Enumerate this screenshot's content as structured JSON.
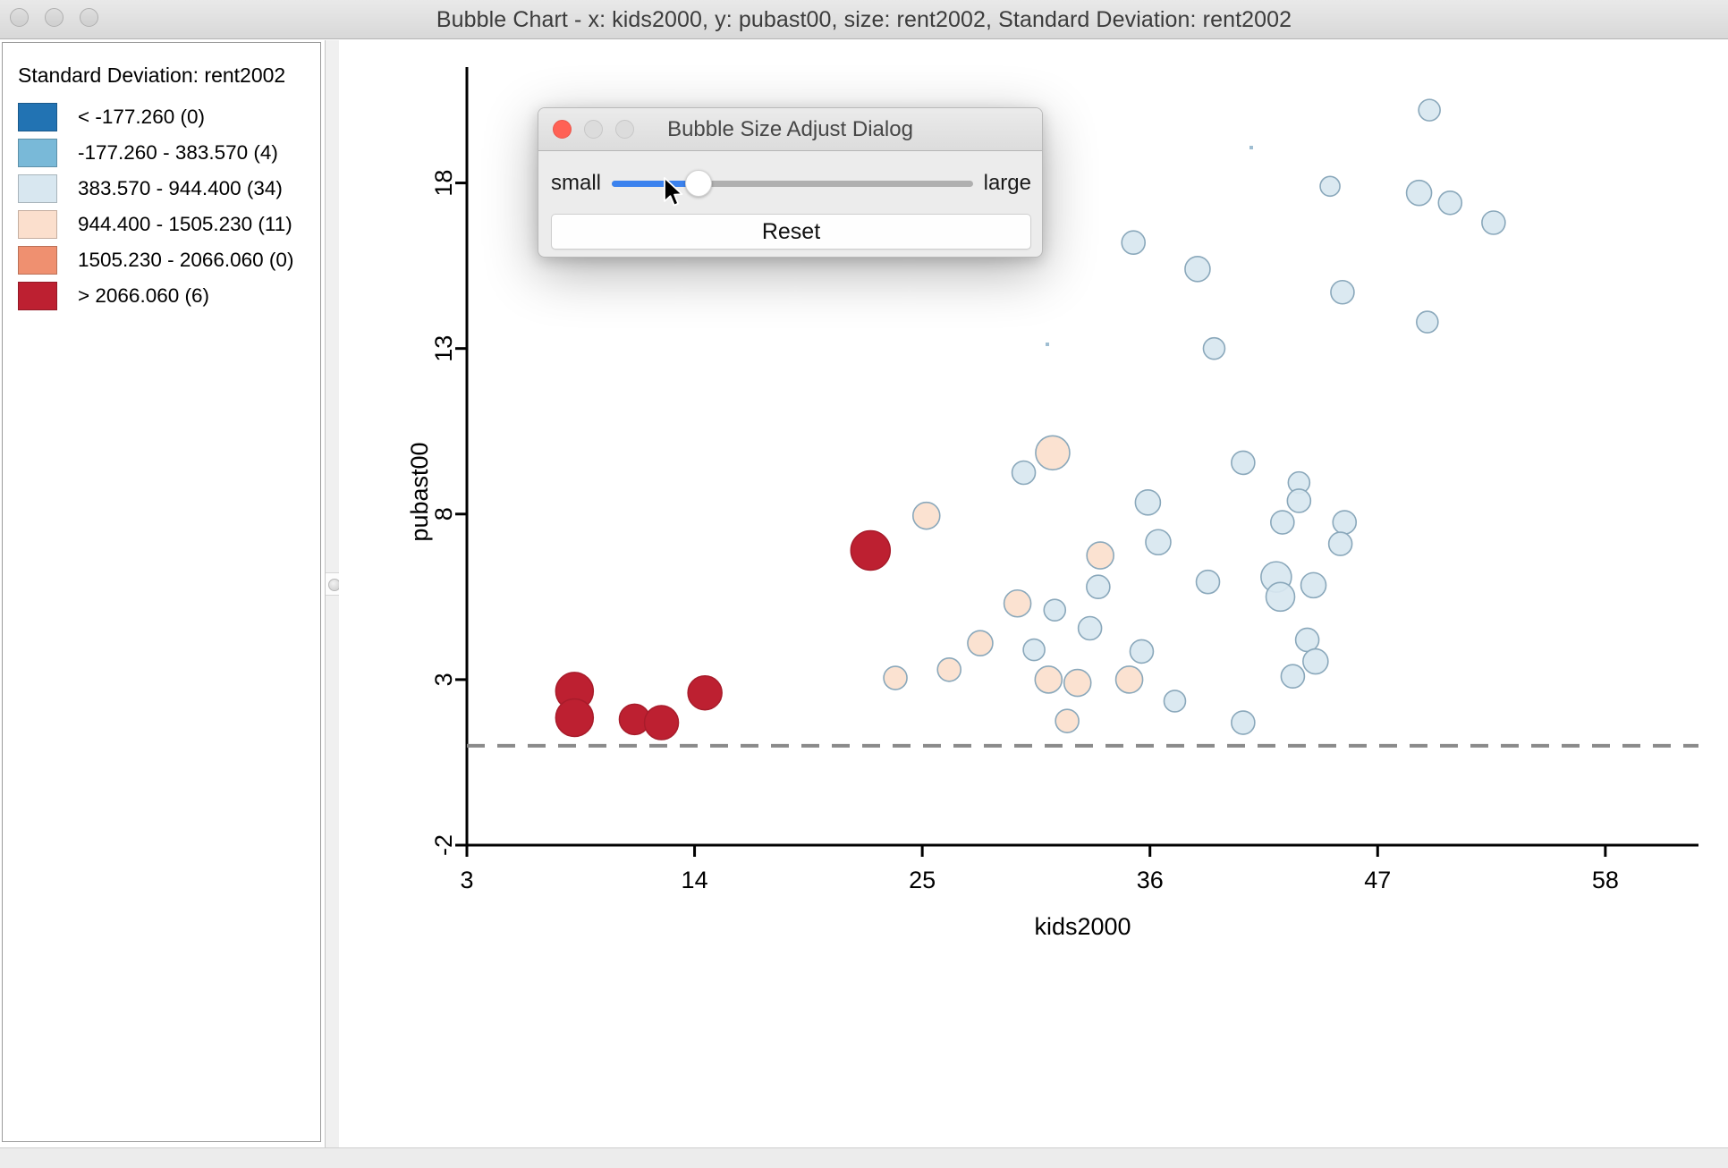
{
  "window": {
    "title": "Bubble Chart - x: kids2000, y: pubast00, size: rent2002, Standard Deviation: rent2002",
    "controls": [
      "close",
      "minimize",
      "maximize"
    ]
  },
  "legend": {
    "title": "Standard Deviation: rent2002",
    "items": [
      {
        "color": "#2273b3",
        "label": "< -177.260 (0)",
        "count": 0
      },
      {
        "color": "#79b9d8",
        "label": "-177.260 - 383.570 (4)",
        "count": 4
      },
      {
        "color": "#d8e7f0",
        "label": "383.570 - 944.400 (34)",
        "count": 34
      },
      {
        "color": "#fbdfcd",
        "label": "944.400 - 1505.230 (11)",
        "count": 11
      },
      {
        "color": "#ef9070",
        "label": "1505.230 - 2066.060 (0)",
        "count": 0
      },
      {
        "color": "#bd2031",
        "label": "> 2066.060 (6)",
        "count": 6
      }
    ]
  },
  "dialog": {
    "title": "Bubble Size Adjust Dialog",
    "slider": {
      "min_label": "small",
      "max_label": "large",
      "value_percent": 24
    },
    "reset_label": "Reset"
  },
  "chart_data": {
    "type": "scatter",
    "title": "Bubble Chart - x: kids2000, y: pubast00, size: rent2002, Standard Deviation: rent2002",
    "xlabel": "kids2000",
    "ylabel": "pubast00",
    "xticks": [
      3,
      14,
      25,
      36,
      47,
      58
    ],
    "yticks": [
      -2,
      3,
      8,
      13,
      18
    ],
    "xlim": [
      3,
      62.5
    ],
    "ylim": [
      -2,
      21.5
    ],
    "grid": false,
    "legend_position": "left-panel",
    "reference_line": {
      "orientation": "horizontal",
      "y": 1.0,
      "style": "dashed",
      "color": "#8a8a8a"
    },
    "size_encodes": "rent2002",
    "color_encodes": "Standard Deviation: rent2002",
    "colors": {
      "low": "#2273b3",
      "mid_low": "#79b9d8",
      "mid": "#d8e7f0",
      "mid_high": "#fbdfcd",
      "high": "#ef9070",
      "very_high": "#bd2031"
    },
    "points": [
      {
        "x": 8.2,
        "y": 2.65,
        "r": 21,
        "color": "#bd2031"
      },
      {
        "x": 8.2,
        "y": 1.85,
        "r": 21,
        "color": "#bd2031"
      },
      {
        "x": 11.1,
        "y": 1.8,
        "r": 17,
        "color": "#bd2031"
      },
      {
        "x": 12.4,
        "y": 1.7,
        "r": 19,
        "color": "#bd2031"
      },
      {
        "x": 14.5,
        "y": 2.6,
        "r": 19,
        "color": "#bd2031"
      },
      {
        "x": 22.5,
        "y": 6.9,
        "r": 22,
        "color": "#bd2031"
      },
      {
        "x": 25.2,
        "y": 7.95,
        "r": 15,
        "color": "#fbdfcd"
      },
      {
        "x": 31.3,
        "y": 9.85,
        "r": 19,
        "color": "#fbdfcd"
      },
      {
        "x": 33.6,
        "y": 6.75,
        "r": 15,
        "color": "#fbdfcd"
      },
      {
        "x": 29.6,
        "y": 5.3,
        "r": 15,
        "color": "#fbdfcd"
      },
      {
        "x": 27.8,
        "y": 4.1,
        "r": 14,
        "color": "#fbdfcd"
      },
      {
        "x": 23.7,
        "y": 3.05,
        "r": 13,
        "color": "#fbdfcd"
      },
      {
        "x": 26.3,
        "y": 3.3,
        "r": 13,
        "color": "#fbdfcd"
      },
      {
        "x": 31.1,
        "y": 3.0,
        "r": 15,
        "color": "#fbdfcd"
      },
      {
        "x": 32.5,
        "y": 2.9,
        "r": 15,
        "color": "#fbdfcd"
      },
      {
        "x": 35.0,
        "y": 3.0,
        "r": 15,
        "color": "#fbdfcd"
      },
      {
        "x": 32.0,
        "y": 1.75,
        "r": 13,
        "color": "#fbdfcd"
      },
      {
        "x": 49.5,
        "y": 20.2,
        "r": 12,
        "color": "#d8e7f0"
      },
      {
        "x": 49.0,
        "y": 17.7,
        "r": 14,
        "color": "#d8e7f0"
      },
      {
        "x": 50.5,
        "y": 17.4,
        "r": 13,
        "color": "#d8e7f0"
      },
      {
        "x": 52.6,
        "y": 16.8,
        "r": 13,
        "color": "#d8e7f0"
      },
      {
        "x": 44.7,
        "y": 17.9,
        "r": 11,
        "color": "#d8e7f0"
      },
      {
        "x": 35.2,
        "y": 16.2,
        "r": 13,
        "color": "#d8e7f0"
      },
      {
        "x": 38.3,
        "y": 15.4,
        "r": 14,
        "color": "#d8e7f0"
      },
      {
        "x": 45.3,
        "y": 14.7,
        "r": 13,
        "color": "#d8e7f0"
      },
      {
        "x": 49.4,
        "y": 13.8,
        "r": 12,
        "color": "#d8e7f0"
      },
      {
        "x": 39.1,
        "y": 13.0,
        "r": 12,
        "color": "#d8e7f0"
      },
      {
        "x": 29.9,
        "y": 9.25,
        "r": 13,
        "color": "#d8e7f0"
      },
      {
        "x": 40.5,
        "y": 9.55,
        "r": 13,
        "color": "#d8e7f0"
      },
      {
        "x": 43.2,
        "y": 8.95,
        "r": 12,
        "color": "#d8e7f0"
      },
      {
        "x": 43.2,
        "y": 8.4,
        "r": 13,
        "color": "#d8e7f0"
      },
      {
        "x": 35.9,
        "y": 8.35,
        "r": 14,
        "color": "#d8e7f0"
      },
      {
        "x": 42.4,
        "y": 7.75,
        "r": 13,
        "color": "#d8e7f0"
      },
      {
        "x": 45.4,
        "y": 7.75,
        "r": 13,
        "color": "#d8e7f0"
      },
      {
        "x": 45.2,
        "y": 7.1,
        "r": 13,
        "color": "#d8e7f0"
      },
      {
        "x": 36.4,
        "y": 7.15,
        "r": 14,
        "color": "#d8e7f0"
      },
      {
        "x": 38.8,
        "y": 5.95,
        "r": 13,
        "color": "#d8e7f0"
      },
      {
        "x": 42.1,
        "y": 6.1,
        "r": 17,
        "color": "#d8e7f0"
      },
      {
        "x": 43.9,
        "y": 5.85,
        "r": 14,
        "color": "#d8e7f0"
      },
      {
        "x": 42.3,
        "y": 5.5,
        "r": 16,
        "color": "#d8e7f0"
      },
      {
        "x": 33.5,
        "y": 5.8,
        "r": 13,
        "color": "#d8e7f0"
      },
      {
        "x": 33.1,
        "y": 4.55,
        "r": 13,
        "color": "#d8e7f0"
      },
      {
        "x": 35.6,
        "y": 3.85,
        "r": 13,
        "color": "#d8e7f0"
      },
      {
        "x": 43.6,
        "y": 4.2,
        "r": 13,
        "color": "#d8e7f0"
      },
      {
        "x": 42.9,
        "y": 3.1,
        "r": 13,
        "color": "#d8e7f0"
      },
      {
        "x": 44.0,
        "y": 3.55,
        "r": 14,
        "color": "#d8e7f0"
      },
      {
        "x": 37.2,
        "y": 2.35,
        "r": 12,
        "color": "#d8e7f0"
      },
      {
        "x": 40.5,
        "y": 1.7,
        "r": 13,
        "color": "#d8e7f0"
      },
      {
        "x": 30.4,
        "y": 3.9,
        "r": 12,
        "color": "#d8e7f0"
      },
      {
        "x": 31.4,
        "y": 5.1,
        "r": 12,
        "color": "#d8e7f0"
      }
    ]
  },
  "statusbar": {
    "text": ""
  }
}
